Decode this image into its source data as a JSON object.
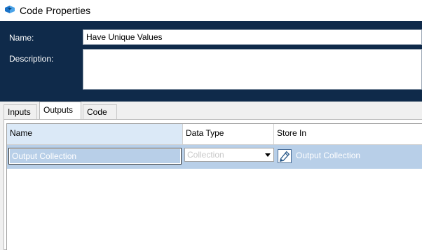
{
  "window": {
    "title": "Code Properties",
    "icon": "code-stage-icon"
  },
  "header": {
    "name_label": "Name:",
    "name_value": "Have Unique Values",
    "description_label": "Description:",
    "description_value": ""
  },
  "tabs": [
    {
      "label": "Inputs",
      "active": false
    },
    {
      "label": "Outputs",
      "active": true
    },
    {
      "label": "Code",
      "active": false
    }
  ],
  "grid": {
    "columns": [
      "Name",
      "Data Type",
      "Store In"
    ],
    "rows": [
      {
        "name": "Output Collection",
        "data_type": "Collection",
        "store_in": "Output Collection",
        "selected": true
      }
    ]
  },
  "colors": {
    "header_background": "#0f2a4a",
    "selected_row": "#b8cfe8",
    "name_column_header": "#dbe9f7"
  }
}
